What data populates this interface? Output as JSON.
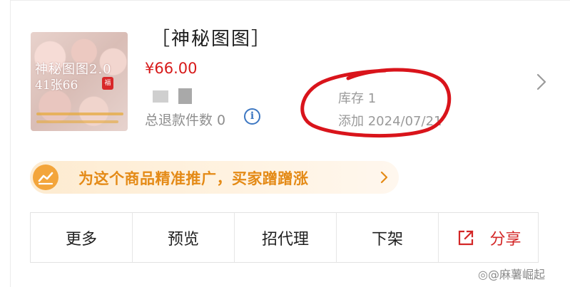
{
  "product": {
    "title": "［神秘图图］",
    "price": "¥66.00",
    "refund_label": "总退款件数 0",
    "info_icon_glyph": "i",
    "stock_label": "库存 1",
    "added_label": "添加 2024/07/21",
    "thumbnail": {
      "title_text": "神秘图图2.0",
      "subtitle_text": "41张66",
      "seal_text": "福"
    }
  },
  "promo": {
    "text": "为这个商品精准推广，买家蹭蹭涨"
  },
  "actions": [
    {
      "label": "更多"
    },
    {
      "label": "预览"
    },
    {
      "label": "招代理"
    },
    {
      "label": "下架"
    },
    {
      "label": "分享"
    }
  ],
  "watermark": "◎@麻薯崛起",
  "colors": {
    "price": "#d71a1a",
    "promo_text": "#e48a16",
    "promo_icon": "#f3a53b",
    "promo_bg": "#fdebd0",
    "info_icon": "#3d77c2",
    "share": "#d32626",
    "annotation_circle": "#d9141b"
  },
  "icons": {
    "row_chevron": "chevron-right-icon",
    "promo_icon": "trend-chart-icon",
    "promo_arrow": "chevron-right-icon",
    "share": "share-external-icon",
    "info": "info-circle-icon"
  }
}
